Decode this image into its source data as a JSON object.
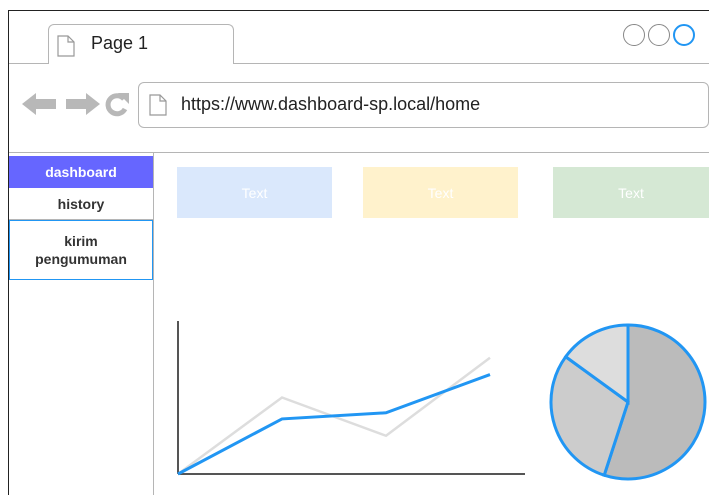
{
  "browser": {
    "tab_title": "Page 1",
    "url": "https://www.dashboard-sp.local/home",
    "accent_color": "#2196f3"
  },
  "sidebar": {
    "items": [
      {
        "label": "dashboard",
        "active": true
      },
      {
        "label": "history"
      },
      {
        "label": "kirim\npengumuman"
      }
    ],
    "active_color": "#6666ff"
  },
  "blocks": [
    {
      "label": "Text",
      "color": "#dae8fc"
    },
    {
      "label": "Text",
      "color": "#fff2cc"
    },
    {
      "label": "Text",
      "color": "#d5e8d4"
    }
  ],
  "chart_data": [
    {
      "type": "line",
      "title": "",
      "xlabel": "",
      "ylabel": "",
      "x": [
        0,
        1,
        2,
        3
      ],
      "series": [
        {
          "values": [
            0,
            0.36,
            0.4,
            0.65
          ],
          "color": "#2196f3"
        },
        {
          "values": [
            0,
            0.5,
            0.25,
            0.76
          ],
          "color": "#dddddd"
        }
      ],
      "ylim": [
        0,
        1
      ],
      "grid": false
    },
    {
      "type": "pie",
      "title": "",
      "values": [
        55,
        30,
        15
      ],
      "colors": [
        "#bbbbbb",
        "#cccccc",
        "#dddddd"
      ],
      "stroke_color": "#2196f3"
    }
  ]
}
